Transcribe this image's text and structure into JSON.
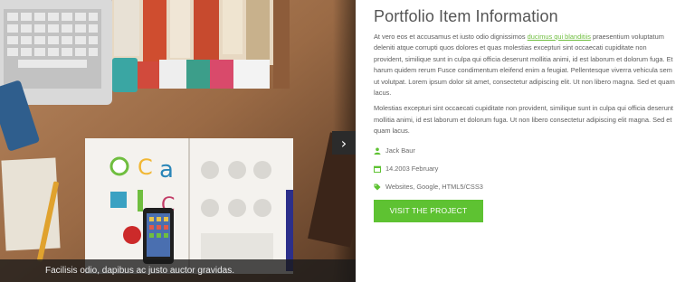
{
  "slider": {
    "caption": "Facilisis odio, dapibus ac justo auctor gravidas.",
    "next_icon": "chevron-right-icon",
    "logo_letters": [
      "C",
      "a",
      "C"
    ]
  },
  "portfolio": {
    "title": "Portfolio Item Information",
    "paragraph1": {
      "before_link": "At vero eos et accusamus et iusto odio dignissimos ",
      "link_text": "ducimus qui blanditiis",
      "after_link": " praesentium voluptatum deleniti atque corrupti quos dolores et quas molestias excepturi sint occaecati cupiditate non provident, similique sunt in culpa qui officia deserunt mollitia animi, id est laborum et dolorum fuga. Et harum quidem rerum Fusce condimentum eleifend enim a feugiat. Pellentesque viverra vehicula sem ut volutpat. Lorem ipsum dolor sit amet, consectetur adipiscing elit. Ut non libero magna. Sed et quam lacus."
    },
    "paragraph2": "Molestias excepturi sint occaecati cupiditate non provident, similique sunt in culpa qui officia deserunt mollitia animi, id est laborum et dolorum fuga. Ut non libero consectetur adipiscing elit magna. Sed et quam lacus.",
    "meta": {
      "author": "Jack Baur",
      "date": "14.2003 February",
      "tags": "Websites, Google, HTML5/CSS3"
    },
    "button_label": "VISIT THE PROJECT"
  },
  "colors": {
    "accent": "#5ec232",
    "link": "#6fbe3f",
    "title": "#555555"
  },
  "icons": {
    "author": "user-icon",
    "date": "calendar-icon",
    "tags": "tag-icon"
  }
}
